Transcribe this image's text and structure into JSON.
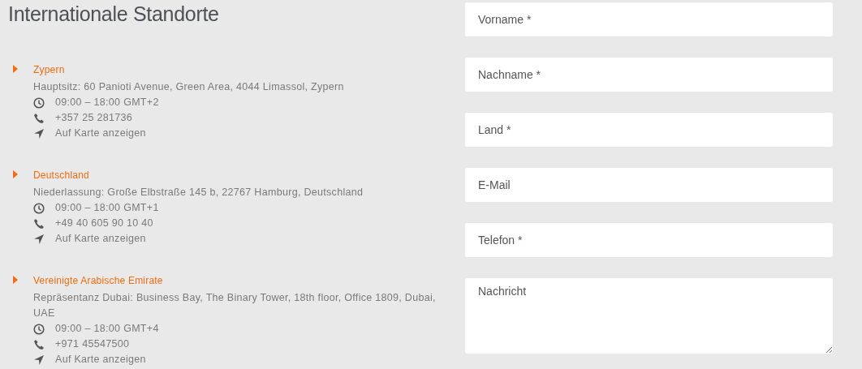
{
  "title": "Internationale Standorte",
  "locations": [
    {
      "name": "Zypern",
      "address": "Hauptsitz: 60 Panioti Avenue, Green Area, 4044 Limassol, Zypern",
      "hours": "09:00 – 18:00 GMT+2",
      "phone": "+357 25 281736",
      "map_link": "Auf Karte anzeigen"
    },
    {
      "name": "Deutschland",
      "address": "Niederlassung: Große Elbstraße 145 b, 22767 Hamburg, Deutschland",
      "hours": "09:00 – 18:00 GMT+1",
      "phone": "+49 40 605 90 10 40",
      "map_link": "Auf Karte anzeigen"
    },
    {
      "name": "Vereinigte Arabische Emirate",
      "address": "Repräsentanz Dubai: Business Bay, The Binary Tower, 18th floor, Office 1809, Dubai, UAE",
      "hours": "09:00 – 18:00 GMT+4",
      "phone": "+971 45547500",
      "map_link": "Auf Karte anzeigen"
    }
  ],
  "form": {
    "fields": [
      {
        "kind": "input",
        "placeholder": "Vorname *"
      },
      {
        "kind": "input",
        "placeholder": "Nachname *"
      },
      {
        "kind": "input",
        "placeholder": "Land *"
      },
      {
        "kind": "input",
        "placeholder": "E-Mail"
      },
      {
        "kind": "input",
        "placeholder": "Telefon *"
      },
      {
        "kind": "textarea",
        "placeholder": "Nachricht"
      }
    ]
  }
}
